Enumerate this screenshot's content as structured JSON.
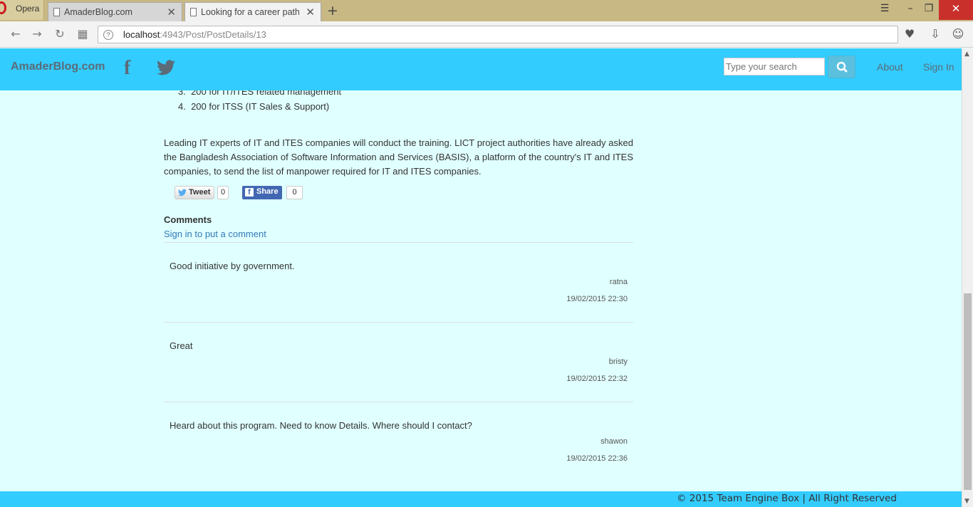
{
  "browser": {
    "menu_label": "Opera",
    "tabs": [
      {
        "title": "AmaderBlog.com"
      },
      {
        "title": "Looking for a career path i"
      }
    ],
    "url_host": "localhost",
    "url_path": ":4943/Post/PostDetails/13"
  },
  "site": {
    "brand": "AmaderBlog.com",
    "search_placeholder": "Type your search",
    "nav": {
      "about": "About",
      "signin": "Sign In"
    },
    "colors": {
      "navbar": "#33ccff",
      "page_bg": "#e0ffff",
      "link": "#337ab7"
    }
  },
  "post": {
    "list_items": [
      {
        "num": "3.",
        "text": "200 for IT/ITES related management"
      },
      {
        "num": "4.",
        "text": "200 for ITSS (IT Sales & Support)"
      }
    ],
    "paragraph": "Leading IT experts of IT and ITES companies will conduct the training. LICT project authorities have already asked the Bangladesh Association of Software Information and Services (BASIS), a platform of the country's IT and ITES companies, to send the list of manpower required for IT and ITES companies.",
    "tweet": {
      "label": "Tweet",
      "count": "0"
    },
    "share": {
      "label": "Share",
      "count": "0"
    }
  },
  "comments": {
    "heading": "Comments",
    "signin_prompt": "Sign in to put a comment",
    "items": [
      {
        "text": "Good initiative by government.",
        "author": "ratna",
        "date": "19/02/2015 22:30"
      },
      {
        "text": "Great",
        "author": "bristy",
        "date": "19/02/2015 22:32"
      },
      {
        "text": "Heard about this program. Need to know Details. Where should I contact?",
        "author": "shawon",
        "date": "19/02/2015 22:36"
      }
    ]
  },
  "footer": {
    "text": "© 2015 Team Engine Box | All Right Reserved"
  }
}
